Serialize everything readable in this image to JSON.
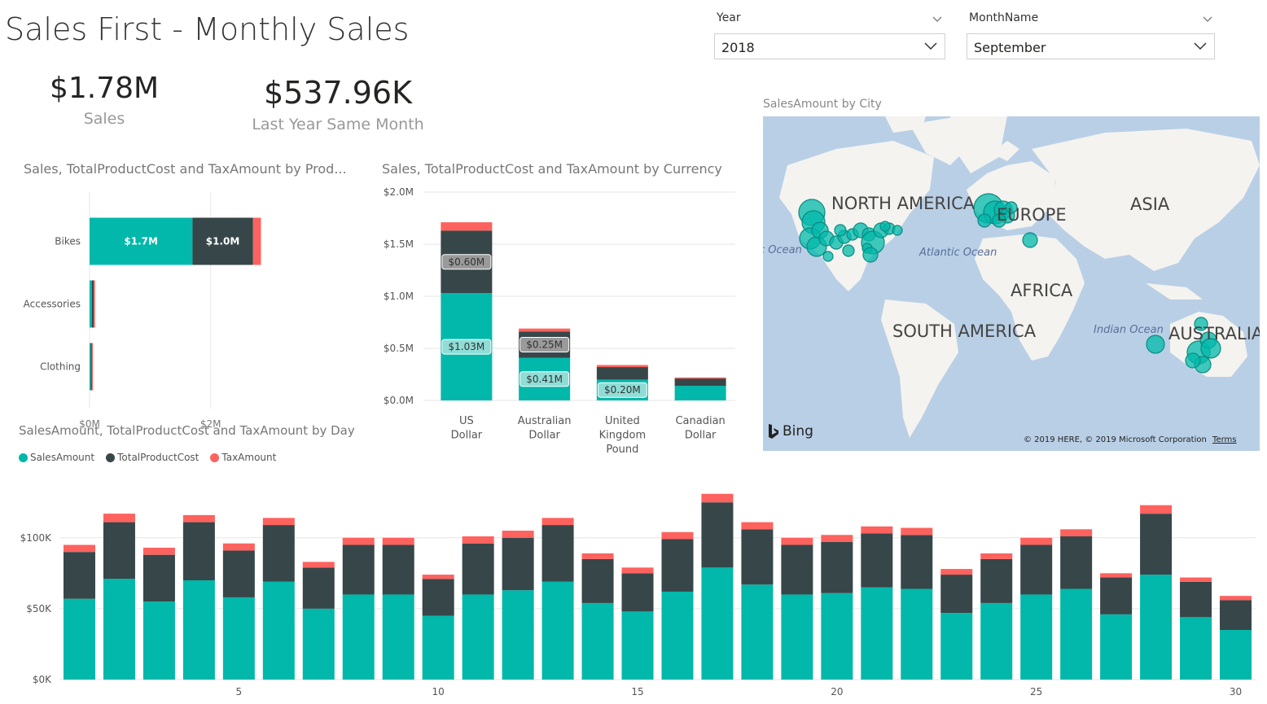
{
  "page": {
    "title": "Sales First - Monthly Sales"
  },
  "slicers": [
    {
      "label": "Year",
      "value": "2018"
    },
    {
      "label": "MonthName",
      "value": "September"
    }
  ],
  "kpis": [
    {
      "value": "$1.78M",
      "label": "Sales"
    },
    {
      "value": "$537.96K",
      "label": "Last Year Same Month"
    }
  ],
  "colors": {
    "sales": "#01B8AA",
    "cost": "#374649",
    "tax": "#FD625E"
  },
  "map": {
    "title": "SalesAmount by City",
    "labels": [
      "NORTH AMERICA",
      "EUROPE",
      "ASIA",
      "AFRICA",
      "SOUTH AMERICA",
      "AUSTRALIA",
      "Atlantic Ocean",
      "Indian Ocean",
      "Pacific Ocean"
    ],
    "brand": "Bing",
    "copyright": "© 2019 HERE, © 2019 Microsoft Corporation",
    "terms": "Terms"
  },
  "chart_data": [
    {
      "type": "bar",
      "orientation": "horizontal",
      "stacked": true,
      "title": "Sales, TotalProductCost and TaxAmount by Prod...",
      "categories": [
        "Bikes",
        "Accessories",
        "Clothing"
      ],
      "series": [
        {
          "name": "SalesAmount",
          "values": [
            1.7,
            0.04,
            0.02
          ],
          "labels": [
            "$1.7M",
            "",
            ""
          ]
        },
        {
          "name": "TotalProductCost",
          "values": [
            1.0,
            0.03,
            0.015
          ],
          "labels": [
            "$1.0M",
            "",
            ""
          ]
        },
        {
          "name": "TaxAmount",
          "values": [
            0.13,
            0.003,
            0.002
          ],
          "labels": [
            "",
            "",
            ""
          ]
        }
      ],
      "xticks": [
        "$0M",
        "$2M"
      ],
      "xlim": [
        0,
        3.9
      ]
    },
    {
      "type": "bar",
      "stacked": true,
      "title": "Sales, TotalProductCost and TaxAmount by Currency",
      "categories": [
        "US Dollar",
        "Australian Dollar",
        "United Kingdom Pound",
        "Canadian Dollar"
      ],
      "series": [
        {
          "name": "SalesAmount",
          "values": [
            1.03,
            0.41,
            0.2,
            0.14
          ],
          "labels": [
            "$1.03M",
            "$0.41M",
            "$0.20M",
            ""
          ]
        },
        {
          "name": "TotalProductCost",
          "values": [
            0.6,
            0.25,
            0.12,
            0.07
          ],
          "labels": [
            "$0.60M",
            "$0.25M",
            "",
            ""
          ]
        },
        {
          "name": "TaxAmount",
          "values": [
            0.08,
            0.03,
            0.02,
            0.01
          ],
          "labels": [
            "",
            "",
            "",
            ""
          ]
        }
      ],
      "yticks": [
        "$0.0M",
        "$0.5M",
        "$1.0M",
        "$1.5M",
        "$2.0M"
      ],
      "ylim": [
        0,
        2.0
      ]
    },
    {
      "type": "bar",
      "stacked": true,
      "title": "SalesAmount, TotalProductCost and TaxAmount by Day",
      "legend": [
        "SalesAmount",
        "TotalProductCost",
        "TaxAmount"
      ],
      "x": [
        1,
        2,
        3,
        4,
        5,
        6,
        7,
        8,
        9,
        10,
        11,
        12,
        13,
        14,
        15,
        16,
        17,
        18,
        19,
        20,
        21,
        22,
        23,
        24,
        25,
        26,
        27,
        28,
        29,
        30
      ],
      "series": [
        {
          "name": "SalesAmount",
          "values": [
            57,
            71,
            55,
            70,
            58,
            69,
            50,
            60,
            60,
            45,
            60,
            63,
            69,
            54,
            48,
            62,
            79,
            67,
            60,
            61,
            65,
            64,
            47,
            54,
            60,
            64,
            46,
            74,
            44,
            35
          ]
        },
        {
          "name": "TotalProductCost",
          "values": [
            33,
            40,
            33,
            41,
            33,
            40,
            29,
            35,
            35,
            26,
            36,
            37,
            40,
            31,
            27,
            37,
            46,
            39,
            35,
            36,
            38,
            38,
            27,
            31,
            35,
            37,
            26,
            43,
            25,
            21
          ]
        },
        {
          "name": "TaxAmount",
          "values": [
            5,
            6,
            5,
            5,
            5,
            5,
            4,
            5,
            5,
            3,
            5,
            5,
            5,
            4,
            4,
            5,
            6,
            5,
            5,
            5,
            5,
            5,
            4,
            4,
            5,
            5,
            3,
            6,
            3,
            3
          ]
        }
      ],
      "xticks": [
        5,
        10,
        15,
        20,
        25,
        30
      ],
      "yticks": [
        "$0K",
        "$50K",
        "$100K"
      ],
      "ylim": [
        0,
        132
      ]
    }
  ]
}
